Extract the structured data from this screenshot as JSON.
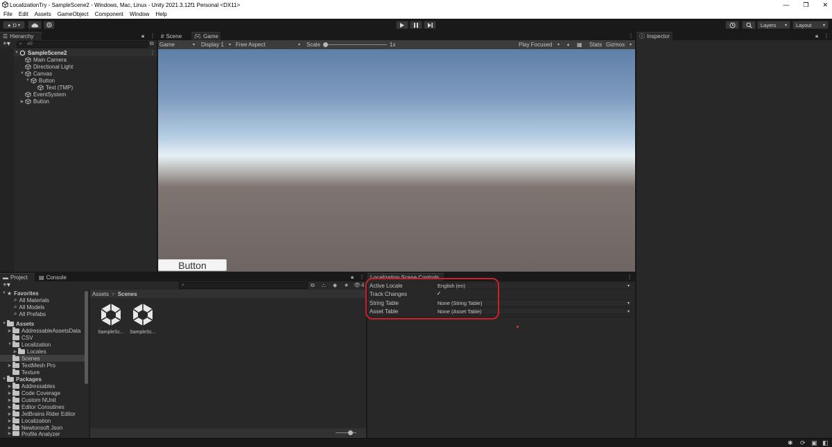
{
  "window": {
    "title": "LocalizationTry - SampleScene2 - Windows, Mac, Linux - Unity 2021.3.12f1 Personal <DX11>",
    "controls": [
      "—",
      "❐",
      "✕"
    ]
  },
  "menu": [
    "File",
    "Edit",
    "Assets",
    "GameObject",
    "Component",
    "Window",
    "Help"
  ],
  "toolbar": {
    "account_label": "D",
    "layers_label": "Layers",
    "layout_label": "Layout"
  },
  "hierarchy": {
    "tab_label": "Hierarchy",
    "search_placeholder": "All",
    "scene_name": "SampleScene2",
    "items": [
      {
        "label": "Main Camera"
      },
      {
        "label": "Directional Light"
      },
      {
        "label": "Canvas"
      },
      {
        "label": "Button"
      },
      {
        "label": "Text (TMP)"
      },
      {
        "label": "EventSystem"
      },
      {
        "label": "Button"
      }
    ]
  },
  "game_view": {
    "tabs": [
      {
        "label": "Scene"
      },
      {
        "label": "Game"
      }
    ],
    "display_mode": "Game",
    "display": "Display 1",
    "aspect": "Free Aspect",
    "scale_label": "Scale",
    "scale_value": "1x",
    "play_mode": "Play Focused",
    "stats_label": "Stats",
    "gizmos_label": "Gizmos",
    "ui_button_label": "Button"
  },
  "inspector": {
    "tab_label": "Inspector"
  },
  "project": {
    "tabs": [
      {
        "label": "Project"
      },
      {
        "label": "Console"
      }
    ],
    "hidden_count": "4",
    "favorites_label": "Favorites",
    "favorites": [
      "All Materials",
      "All Models",
      "All Prefabs"
    ],
    "assets_label": "Assets",
    "asset_folders": [
      {
        "label": "AddressableAssetsData"
      },
      {
        "label": "CSV"
      },
      {
        "label": "Localization"
      },
      {
        "label": "Locales"
      },
      {
        "label": "Scenes"
      },
      {
        "label": "TextMesh Pro"
      },
      {
        "label": "Texture"
      }
    ],
    "packages_label": "Packages",
    "packages": [
      "Addressables",
      "Code Coverage",
      "Custom NUnit",
      "Editor Coroutines",
      "JetBrains Rider Editor",
      "Localization",
      "Newtonsoft Json",
      "Profile Analyzer"
    ],
    "breadcrumb": [
      "Assets",
      "Scenes"
    ],
    "breadcrumb_sep": ">",
    "files": [
      {
        "label": "SampleSc..."
      },
      {
        "label": "SampleSc..."
      }
    ]
  },
  "localization": {
    "tab_label": "Localization Scene Controls",
    "fields": [
      {
        "label": "Active Locale",
        "value": "English (en)"
      },
      {
        "label": "Track Changes",
        "value": "✓"
      },
      {
        "label": "String Table",
        "value": "None (String Table)"
      },
      {
        "label": "Asset Table",
        "value": "None (Asset Table)"
      }
    ]
  },
  "colors": {
    "highlight": "#cc1f2a",
    "panel_bg": "#282828",
    "app_bg": "#191919"
  }
}
